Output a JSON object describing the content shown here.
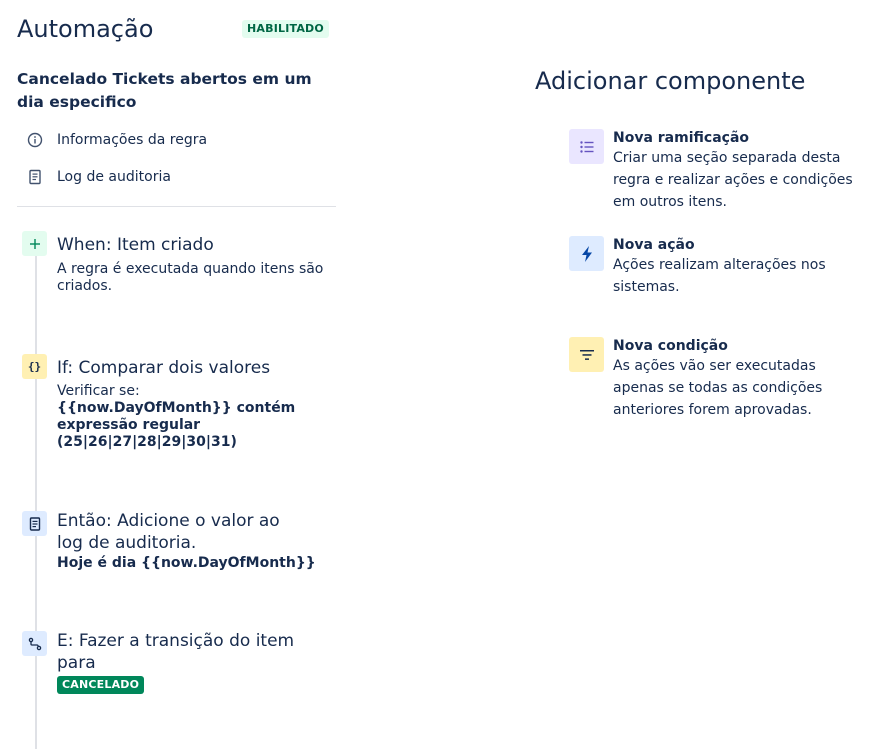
{
  "header": {
    "title": "Automação",
    "status_badge": "HABILITADO"
  },
  "rule": {
    "name": "Cancelado Tickets abertos em um dia especifico"
  },
  "nav": [
    {
      "label": "Informações da regra",
      "icon": "info-icon"
    },
    {
      "label": "Log de auditoria",
      "icon": "document-icon"
    }
  ],
  "steps": {
    "trigger": {
      "icon": "plus-icon",
      "title": "When: Item criado",
      "description": "A regra é executada quando itens são criados."
    },
    "condition": {
      "icon": "braces-icon",
      "title": "If: Comparar dois valores",
      "prefix": "Verificar se:",
      "detail": "{{now.DayOfMonth}} contém expressão regular (25|26|27|28|29|30|31)"
    },
    "action_log": {
      "icon": "document-icon",
      "title": "Então: Adicione o valor ao log de auditoria.",
      "detail": "Hoje é dia {{now.DayOfMonth}}"
    },
    "action_transition": {
      "icon": "transition-icon",
      "title": "E: Fazer a transição do item para",
      "status": "CANCELADO"
    }
  },
  "add_panel": {
    "title": "Adicionar componente",
    "components": [
      {
        "title": "Nova ramificação",
        "description": "Criar uma seção separada desta regra e realizar ações e condições em outros itens.",
        "icon": "branch-list-icon",
        "color": "#eae6ff"
      },
      {
        "title": "Nova ação",
        "description": "Ações realizam alterações nos sistemas.",
        "icon": "lightning-icon",
        "color": "#deebff"
      },
      {
        "title": "Nova condição",
        "description": "As ações vão ser executadas apenas se todas as condições anteriores forem aprovadas.",
        "icon": "filter-icon",
        "color": "#fff0b3"
      }
    ]
  },
  "colors": {
    "text": "#172b4d",
    "enabled_badge_bg": "#e3fcef",
    "enabled_badge_text": "#006644",
    "cancel_badge_bg": "#00875a",
    "trigger_icon_bg": "#e3fcef",
    "condition_icon_bg": "#fff0b3",
    "action_icon_bg": "#deebff"
  }
}
